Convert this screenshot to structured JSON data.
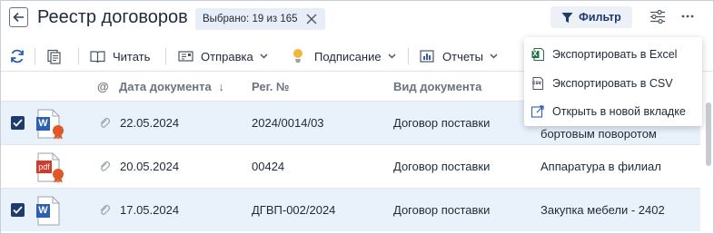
{
  "header": {
    "title": "Реестр договоров",
    "selected_label": "Выбрано: 19 из 165",
    "filter_label": "Фильтр"
  },
  "toolbar": {
    "read_label": "Читать",
    "send_label": "Отправка",
    "sign_label": "Подписание",
    "reports_label": "Отчеты"
  },
  "table": {
    "columns": {
      "attach": "@",
      "date": "Дата документа",
      "date_sort": "↓",
      "reg": "Рег. №",
      "kind": "Вид документа"
    },
    "rows": [
      {
        "checked": true,
        "file_type": "word",
        "has_stamp": true,
        "date": "22.05.2024",
        "reg": "2024/0014/03",
        "kind": "Договор поставки",
        "subject": "бортовым поворотом"
      },
      {
        "checked": false,
        "file_type": "pdf",
        "file_label": "pdf",
        "has_stamp": true,
        "date": "20.05.2024",
        "reg": "00424",
        "kind": "Договор поставки",
        "subject": "Аппаратура в филиал"
      },
      {
        "checked": true,
        "file_type": "word",
        "has_stamp": false,
        "date": "17.05.2024",
        "reg": "ДГВП-002/2024",
        "kind": "Договор поставки",
        "subject": "Закупка мебели - 2402"
      }
    ]
  },
  "menu": {
    "items": [
      {
        "label": "Экспортировать в Excel",
        "icon": "excel-icon"
      },
      {
        "label": "Экспортировать в CSV",
        "icon": "csv-icon",
        "icon_text": "csv"
      },
      {
        "label": "Открыть в новой вкладке",
        "icon": "open-new-tab-icon"
      }
    ]
  },
  "icons": {
    "word_letter": "W",
    "excel_letter": "X"
  },
  "colors": {
    "accent": "#1e3a6e",
    "selected_row": "#e9f1fb",
    "word_blue": "#2b5fb4",
    "pdf_red": "#d13b2b",
    "stamp_orange": "#e0572b",
    "excel_green": "#217346"
  }
}
